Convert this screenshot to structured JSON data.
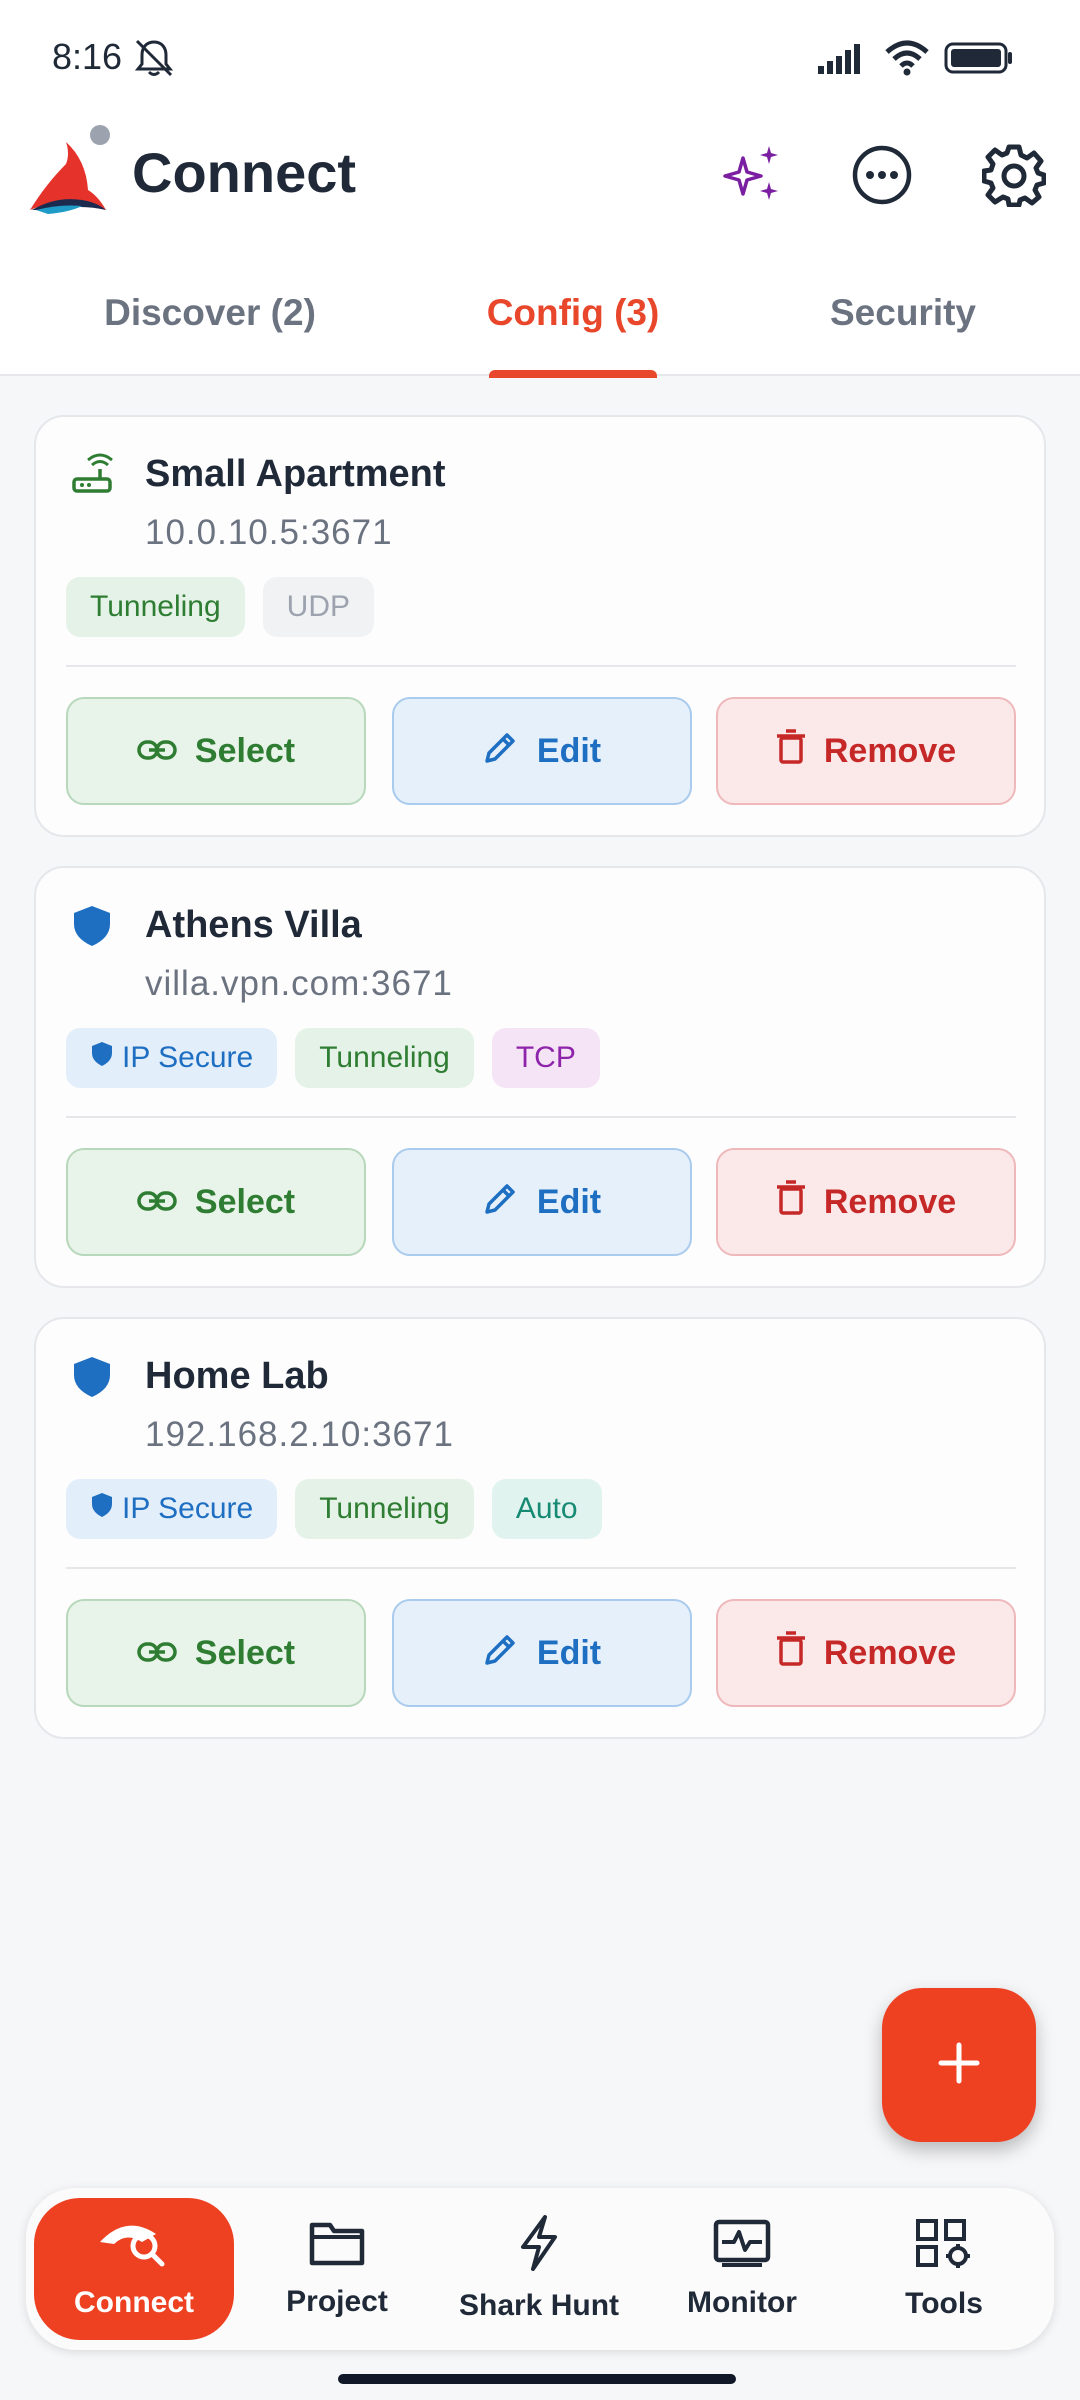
{
  "status_bar": {
    "time": "8:16"
  },
  "app": {
    "title": "Connect"
  },
  "tabs": [
    {
      "label": "Discover (2)",
      "active": false
    },
    {
      "label": "Config (3)",
      "active": true
    },
    {
      "label": "Security",
      "active": false
    }
  ],
  "configs": [
    {
      "icon": "router-icon",
      "name": "Small Apartment",
      "address": "10.0.10.5:3671",
      "chips": [
        {
          "label": "Tunneling",
          "style": "green"
        },
        {
          "label": "UDP",
          "style": "gray"
        }
      ]
    },
    {
      "icon": "shield-icon",
      "name": "Athens Villa",
      "address": "villa.vpn.com:3671",
      "chips": [
        {
          "label": "IP Secure",
          "style": "blue"
        },
        {
          "label": "Tunneling",
          "style": "green"
        },
        {
          "label": "TCP",
          "style": "purple"
        }
      ]
    },
    {
      "icon": "shield-icon",
      "name": "Home Lab",
      "address": "192.168.2.10:3671",
      "chips": [
        {
          "label": "IP Secure",
          "style": "blue"
        },
        {
          "label": "Tunneling",
          "style": "green"
        },
        {
          "label": "Auto",
          "style": "teal"
        }
      ]
    }
  ],
  "actions": {
    "select": "Select",
    "edit": "Edit",
    "remove": "Remove"
  },
  "bottom_nav": [
    {
      "label": "Connect",
      "active": true
    },
    {
      "label": "Project",
      "active": false
    },
    {
      "label": "Shark Hunt",
      "active": false
    },
    {
      "label": "Monitor",
      "active": false
    },
    {
      "label": "Tools",
      "active": false
    }
  ],
  "colors": {
    "accent": "#ee4122",
    "green": "#2e7d32",
    "blue": "#1e6fc2",
    "red": "#c62828"
  }
}
